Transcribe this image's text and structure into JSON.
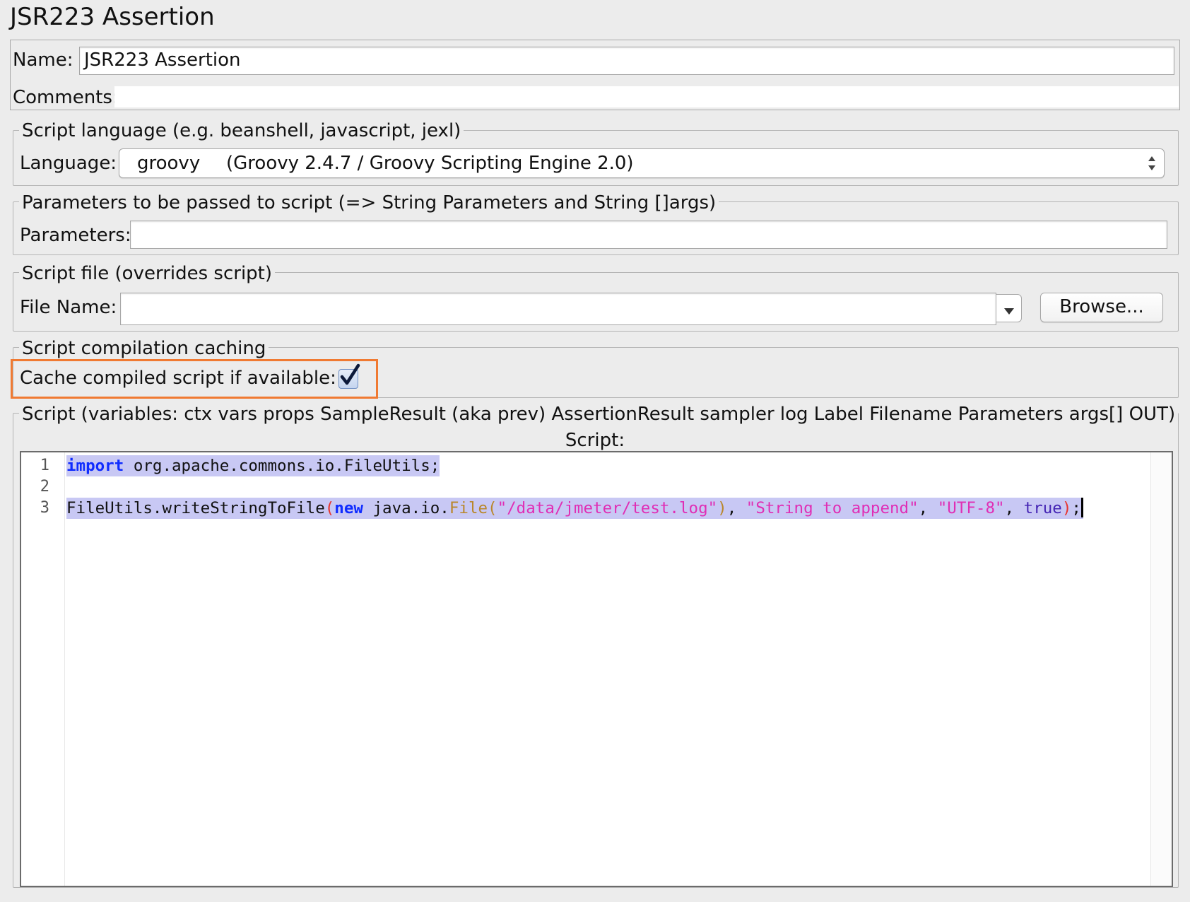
{
  "page_title": "JSR223 Assertion",
  "name_panel": {
    "name_label": "Name:",
    "name_value": "JSR223 Assertion",
    "comments_label": "Comments:",
    "comments_value": ""
  },
  "script_language": {
    "legend": "Script language (e.g. beanshell, javascript, jexl)",
    "label": "Language:",
    "selected_language": "groovy",
    "selected_engine": "(Groovy 2.4.7 / Groovy Scripting Engine 2.0)"
  },
  "parameters": {
    "legend": "Parameters to be passed to script (=> String Parameters and String []args)",
    "label": "Parameters:",
    "value": ""
  },
  "script_file": {
    "legend": "Script file (overrides script)",
    "label": "File Name:",
    "value": "",
    "browse_label": "Browse..."
  },
  "caching": {
    "legend": "Script compilation caching",
    "label": "Cache compiled script if available:",
    "checked": true
  },
  "script": {
    "legend": "Script (variables: ctx vars props SampleResult (aka prev) AssertionResult sampler log Label Filename Parameters args[] OUT)",
    "editor_label": "Script:",
    "line_numbers": [
      "1",
      "2",
      "3"
    ],
    "line1": {
      "kw_import": "import",
      "rest": " org.apache.commons.io.FileUtils;"
    },
    "line3": {
      "receiver": "FileUtils.writeStringToFile",
      "open_paren": "(",
      "kw_new": "new",
      "pkg": " java.io.",
      "cls_file": "File",
      "open_paren2": "(",
      "str_path": "\"/data/jmeter/test.log\"",
      "close_paren2": ")",
      "comma1": ", ",
      "str_content": "\"String to append\"",
      "comma2": ", ",
      "str_encoding": "\"UTF-8\"",
      "comma3": ", ",
      "lit_true": "true",
      "close_paren": ")",
      "semicolon": ";"
    }
  },
  "colors": {
    "selection": "#c8c8f4",
    "keyword": "#0f2cff",
    "string": "#e02eb5",
    "class": "#b9872b",
    "paren": "#e8342c",
    "literal": "#4424b4",
    "highlight_border": "#f07a32"
  }
}
